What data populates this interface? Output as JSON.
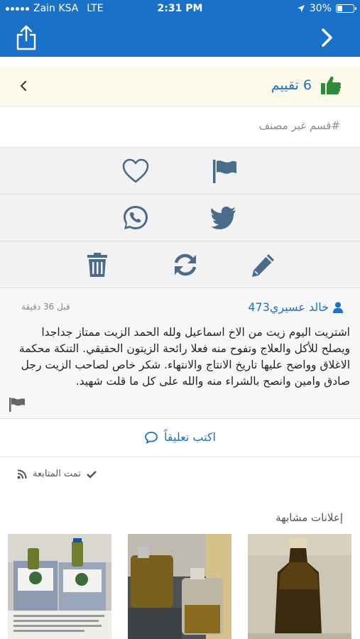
{
  "status": {
    "carrier": "Zain KSA",
    "network": "LTE",
    "time": "2:31 PM",
    "battery": "30%",
    "battery_level": 0.3
  },
  "nav": {
    "share_icon": "share-icon",
    "forward_icon": "chevron-right-icon"
  },
  "rating": {
    "text": "6 تقييم",
    "icon": "thumbs-up-icon",
    "icon_color": "#2e8b3a"
  },
  "category": {
    "text": "#قسم غير مصنف"
  },
  "actions": {
    "row1": [
      "flag-icon",
      "heart-icon"
    ],
    "row2": [
      "twitter-icon",
      "whatsapp-icon"
    ],
    "row3": [
      "edit-icon",
      "refresh-icon",
      "delete-icon"
    ]
  },
  "comment": {
    "author": "خالد عسيري473",
    "time": "قبل 36 دقيقة",
    "body": "اشتريت اليوم زيت من الاخ اسماعيل ولله الحمد الزيت ممتاز جداجدا ويصلح للأكل والعلاج وتفوح منه فعلا رائحة الزيتون الحقيقي. التنكة محكمة الاغلاق وواضح عليها تاريخ الانتاج والانتهاء. شكر خاص لصاحب الزيت رجل صادق وامين وانصح بالشراء منه والله على كل ما قلت شهيد."
  },
  "write_comment": {
    "label": "اكتب تعليقاً"
  },
  "follow": {
    "label": "تمت المتابعة"
  },
  "similar": {
    "title": "إعلانات مشابهة"
  },
  "colors": {
    "brand": "#1a72c8",
    "rating_bg": "#fdfaeb"
  }
}
